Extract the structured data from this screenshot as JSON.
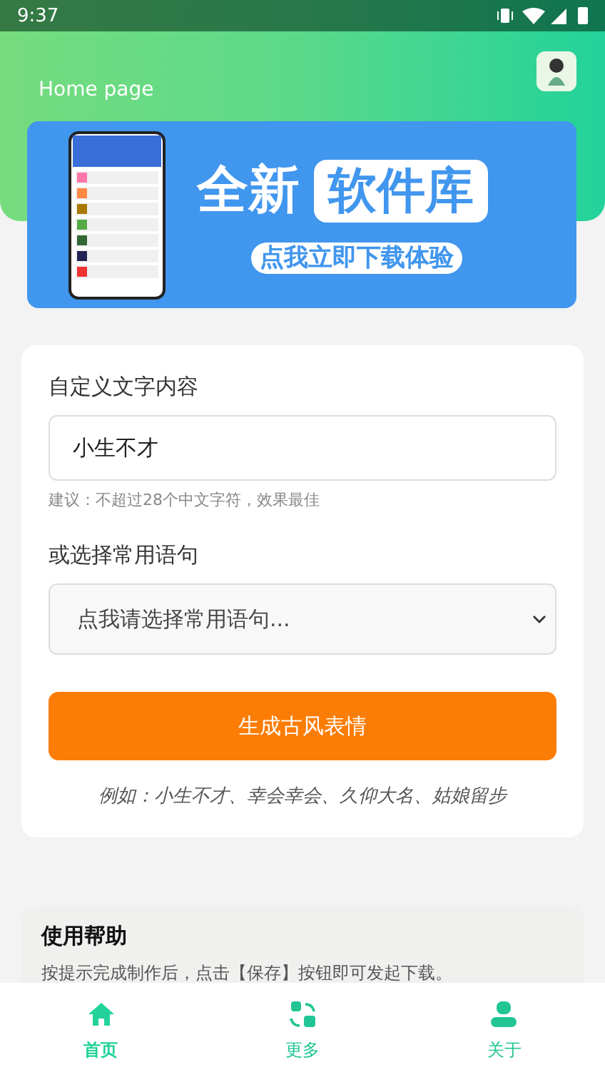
{
  "status_bar": {
    "time": "9:37"
  },
  "header": {
    "title": "Home page"
  },
  "banner": {
    "headline": "全新",
    "highlight": "软件库",
    "cta": "点我立即下载体验"
  },
  "form": {
    "custom_label": "自定义文字内容",
    "custom_value": "小生不才",
    "hint": "建议：不超过28个中文字符，效果最佳",
    "preset_label": "或选择常用语句",
    "preset_placeholder": "点我请选择常用语句...",
    "generate_button": "生成古风表情",
    "example": "例如：小生不才、幸会幸会、久仰大名、姑娘留步"
  },
  "help": {
    "title": "使用帮助",
    "text": "按提示完成制作后，点击【保存】按钮即可发起下载。"
  },
  "tab_bar": [
    {
      "kind": "home",
      "label": "首页",
      "selected": true
    },
    {
      "kind": "more",
      "label": "更多",
      "selected": false
    },
    {
      "kind": "about",
      "label": "关于",
      "selected": false
    }
  ]
}
